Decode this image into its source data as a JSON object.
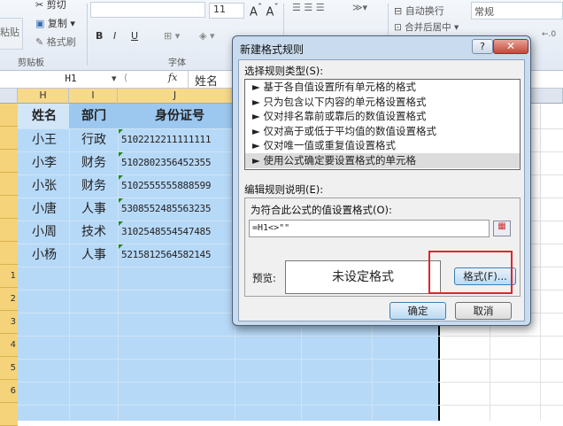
{
  "ribbon": {
    "cut": "剪切",
    "copy": "复制",
    "format_painter": "格式刷",
    "paste": "粘贴",
    "clipboard_group": "剪贴板",
    "font_group": "字体",
    "font_size": "11",
    "wrap_text": "自动换行",
    "merge_center": "合并后居中",
    "number_format": "常规",
    "bold": "B",
    "italic": "I",
    "underline": "U"
  },
  "formula_bar": {
    "name_box": "H1",
    "fx": "fx",
    "value": "姓名"
  },
  "columns": [
    "H",
    "I",
    "J"
  ],
  "row_numbers": [
    "1",
    "2",
    "3",
    "4",
    "5",
    "6"
  ],
  "table": {
    "headers": [
      "姓名",
      "部门",
      "身份证号"
    ],
    "rows": [
      [
        "小王",
        "行政",
        "5102212211111111"
      ],
      [
        "小李",
        "财务",
        "5102802356452355"
      ],
      [
        "小张",
        "财务",
        "5102555555888599"
      ],
      [
        "小唐",
        "人事",
        "5308552485563235"
      ],
      [
        "小周",
        "技术",
        "3102548554547485"
      ],
      [
        "小杨",
        "人事",
        "5215812564582145"
      ]
    ]
  },
  "dialog": {
    "title": "新建格式规则",
    "help": "?",
    "close": "✕",
    "rule_type_label": "选择规则类型(S):",
    "rule_types": [
      "基于各自值设置所有单元格的格式",
      "只为包含以下内容的单元格设置格式",
      "仅对排名靠前或靠后的数值设置格式",
      "仅对高于或低于平均值的数值设置格式",
      "仅对唯一值或重复值设置格式",
      "使用公式确定要设置格式的单元格"
    ],
    "edit_label": "编辑规则说明(E):",
    "formula_label": "为符合此公式的值设置格式(O):",
    "formula_value": "=H1<>\"\"",
    "preview_label": "预览:",
    "preview_text": "未设定格式",
    "format_button": "格式(F)...",
    "ok": "确定",
    "cancel": "取消"
  },
  "colors": {
    "selection": "#b7d9f8",
    "highlight": "#e0252b"
  }
}
